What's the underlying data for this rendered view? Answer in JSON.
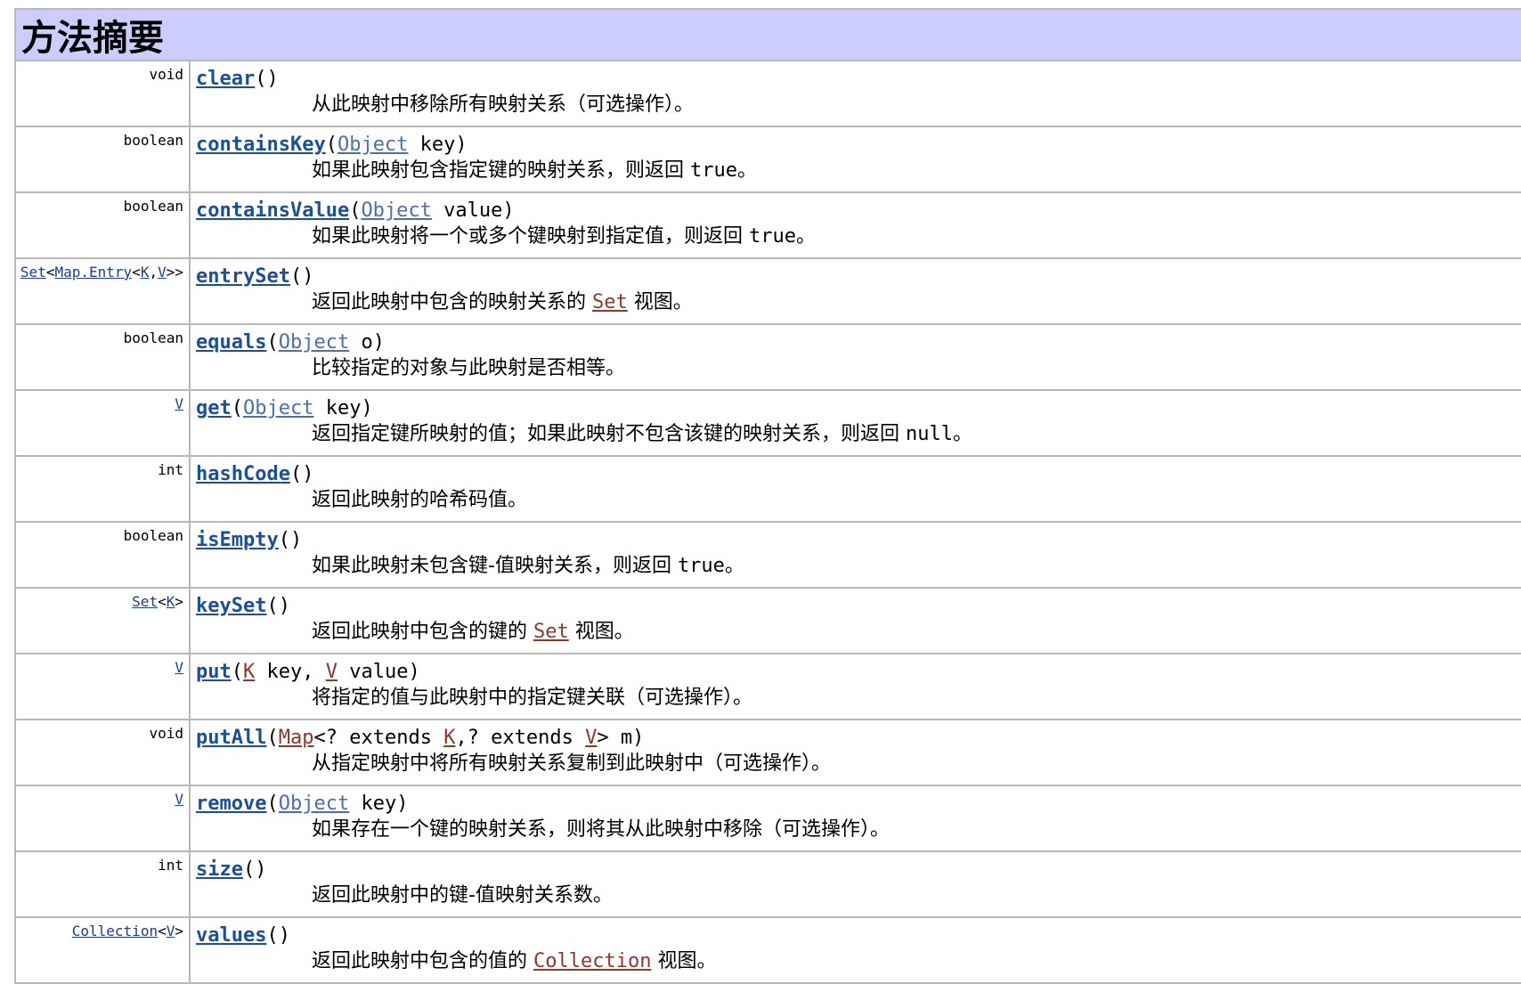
{
  "header": {
    "title": "方法摘要"
  },
  "rows": [
    {
      "type": "void",
      "method": "clear",
      "params": "()",
      "desc": "从此映射中移除所有映射关系（可选操作）。"
    },
    {
      "type": "boolean",
      "method": "containsKey",
      "p_open": "(",
      "p_type": "Object",
      "p_rest": " key)",
      "desc_pre": "如果此映射包含指定键的映射关系，则返回 ",
      "desc_code": "true",
      "desc_post": "。"
    },
    {
      "type": "boolean",
      "method": "containsValue",
      "p_open": "(",
      "p_type": "Object",
      "p_rest": " value)",
      "desc_pre": "如果此映射将一个或多个键映射到指定值，则返回 ",
      "desc_code": "true",
      "desc_post": "。"
    },
    {
      "type_set": "Set",
      "type_lt": "<",
      "type_entry": "Map.Entry",
      "type_lt2": "<",
      "type_k": "K",
      "type_comma": ",",
      "type_v": "V",
      "type_gt": ">>",
      "method": "entrySet",
      "params": "()",
      "desc_pre": "返回此映射中包含的映射关系的 ",
      "desc_link": "Set",
      "desc_post": " 视图。"
    },
    {
      "type": "boolean",
      "method": "equals",
      "p_open": "(",
      "p_type": "Object",
      "p_rest": " o)",
      "desc": "比较指定的对象与此映射是否相等。"
    },
    {
      "type_v": "V",
      "method": "get",
      "p_open": "(",
      "p_type": "Object",
      "p_rest": " key)",
      "desc_pre": "返回指定键所映射的值；如果此映射不包含该键的映射关系，则返回 ",
      "desc_code": "null",
      "desc_post": "。"
    },
    {
      "type": "int",
      "method": "hashCode",
      "params": "()",
      "desc": "返回此映射的哈希码值。"
    },
    {
      "type": "boolean",
      "method": "isEmpty",
      "params": "()",
      "desc_pre": "如果此映射未包含键-值映射关系，则返回 ",
      "desc_code": "true",
      "desc_post": "。"
    },
    {
      "type_set": "Set",
      "type_lt": "<",
      "type_k": "K",
      "type_gt": ">",
      "method": "keySet",
      "params": "()",
      "desc_pre": "返回此映射中包含的键的 ",
      "desc_link": "Set",
      "desc_post": " 视图。"
    },
    {
      "type_v": "V",
      "method": "put",
      "p_open": "(",
      "p_k": "K",
      "p_mid": " key, ",
      "p_v": "V",
      "p_rest": " value)",
      "desc": "将指定的值与此映射中的指定键关联（可选操作）。"
    },
    {
      "type": "void",
      "method": "putAll",
      "p_open": "(",
      "p_map": "Map",
      "p_a": "<? extends ",
      "p_k": "K",
      "p_b": ",? extends ",
      "p_v": "V",
      "p_rest": "> m)",
      "desc": "从指定映射中将所有映射关系复制到此映射中（可选操作）。"
    },
    {
      "type_v": "V",
      "method": "remove",
      "p_open": "(",
      "p_type": "Object",
      "p_rest": " key)",
      "desc": "如果存在一个键的映射关系，则将其从此映射中移除（可选操作）。"
    },
    {
      "type": "int",
      "method": "size",
      "params": "()",
      "desc": "返回此映射中的键-值映射关系数。"
    },
    {
      "type_coll": "Collection",
      "type_lt": "<",
      "type_v": "V",
      "type_gt": ">",
      "method": "values",
      "params": "()",
      "desc_pre": "返回此映射中包含的值的 ",
      "desc_link": "Collection",
      "desc_post": " 视图。"
    }
  ]
}
